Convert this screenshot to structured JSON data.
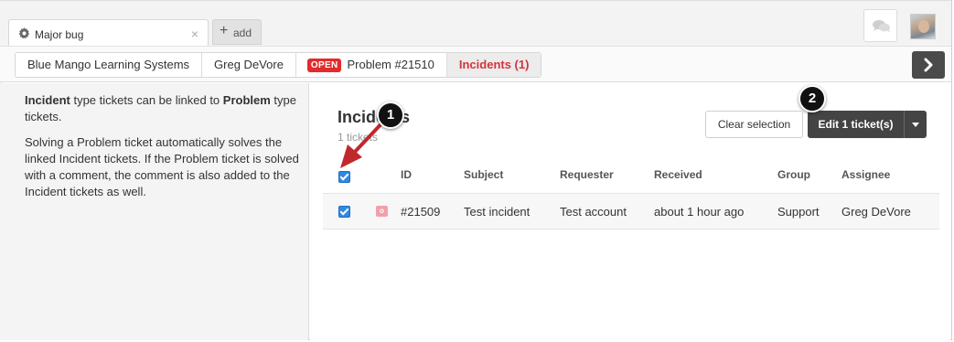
{
  "tabs": {
    "active_title": "Major bug",
    "add_label": "add"
  },
  "breadcrumbs": {
    "organization": "Blue Mango Learning Systems",
    "requester": "Greg DeVore",
    "status_badge": "OPEN",
    "problem": "Problem #21510",
    "incidents": "Incidents (1)"
  },
  "sidebar": {
    "p1_bold1": "Incident",
    "p1_text1": " type tickets can be linked to ",
    "p1_bold2": "Problem",
    "p1_text2": " type tickets.",
    "p2": "Solving a Problem ticket automatically solves the linked Incident tickets. If the Problem ticket is solved with a comment, the comment is also added to the Incident tickets as well."
  },
  "main": {
    "title": "Incidents",
    "count": "1 tickets",
    "clear_label": "Clear selection",
    "edit_label": "Edit 1 ticket(s)"
  },
  "table": {
    "columns": [
      "ID",
      "Subject",
      "Requester",
      "Received",
      "Group",
      "Assignee"
    ],
    "rows": [
      {
        "type_icon": "incident-icon",
        "type_letter": "o",
        "id": "#21509",
        "subject": "Test incident",
        "requester": "Test account",
        "received": "about 1 hour ago",
        "group": "Support",
        "assignee": "Greg DeVore"
      }
    ]
  },
  "annotations": [
    "1",
    "2"
  ],
  "colors": {
    "open_badge": "#e22b2b",
    "active_crumb_text": "#d2343b",
    "checkbox": "#2f8ae3",
    "arrow": "#c0282b",
    "edit_button": "#444444"
  }
}
